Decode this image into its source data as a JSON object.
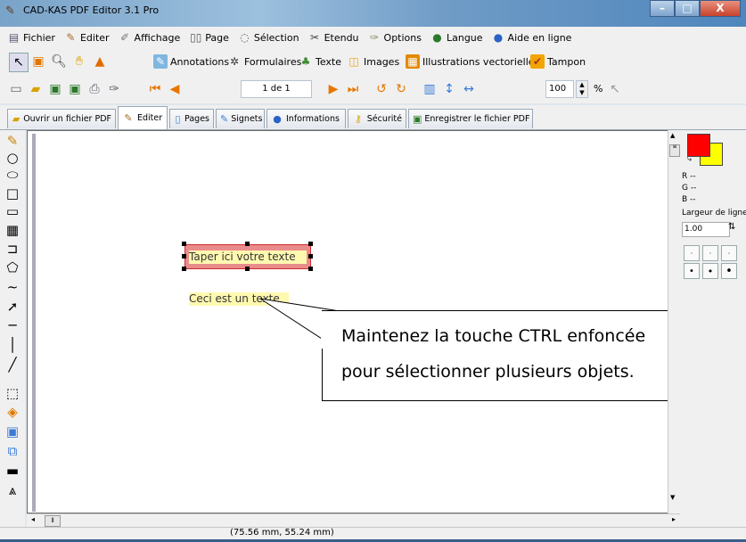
{
  "window": {
    "title": "CAD-KAS PDF Editor 3.1 Pro",
    "min": "–",
    "max": "□",
    "close": "X"
  },
  "menu": [
    {
      "label": "Fichier",
      "icon": "file-icon"
    },
    {
      "label": "Editer",
      "icon": "pen-icon"
    },
    {
      "label": "Affichage",
      "icon": "view-icon"
    },
    {
      "label": "Page",
      "icon": "book-icon"
    },
    {
      "label": "Sélection",
      "icon": "lasso-icon"
    },
    {
      "label": "Etendu",
      "icon": "extended-icon"
    },
    {
      "label": "Options",
      "icon": "options-icon"
    },
    {
      "label": "Langue",
      "icon": "globe-icon"
    },
    {
      "label": "Aide en ligne",
      "icon": "help-icon"
    }
  ],
  "toolbar2": {
    "annotations": "Annotations",
    "formulaires": "Formulaires",
    "texte": "Texte",
    "images": "Images",
    "illustrations": "Illustrations vectorielles",
    "tampon": "Tampon"
  },
  "toolbar3": {
    "page": "1 de 1",
    "zoom": "100",
    "percent": "%"
  },
  "tabs": [
    {
      "label": "Ouvrir un fichier PDF"
    },
    {
      "label": "Editer"
    },
    {
      "label": "Pages"
    },
    {
      "label": "Signets"
    },
    {
      "label": "Informations"
    },
    {
      "label": "Sécurité"
    },
    {
      "label": "Enregistrer le fichier PDF"
    }
  ],
  "canvas": {
    "textbox1": "Taper ici votre texte",
    "textbox2": "Ceci est un texte"
  },
  "callout": {
    "line1": "Maintenez la touche CTRL enfoncée",
    "line2": "pour sélectionner plusieurs objets."
  },
  "rightpanel": {
    "r": "R --",
    "g": "G --",
    "b": "B --",
    "width_label": "Largeur de ligne",
    "width_value": "1.00",
    "primary_color": "#ff0000",
    "secondary_color": "#ffff00"
  },
  "status": {
    "coord": "(75.56 mm, 55.24 mm)"
  }
}
